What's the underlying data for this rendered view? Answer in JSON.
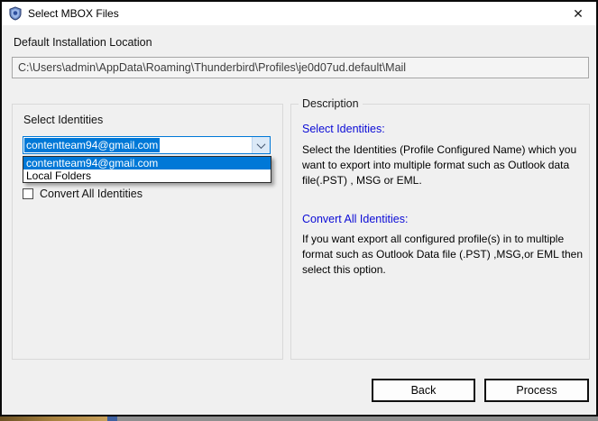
{
  "window": {
    "title": "Select MBOX Files",
    "close_glyph": "✕"
  },
  "location": {
    "label": "Default Installation Location",
    "path": "C:\\Users\\admin\\AppData\\Roaming\\Thunderbird\\Profiles\\je0d07ud.default\\Mail"
  },
  "identities": {
    "label": "Select Identities",
    "value": "contentteam94@gmail.com",
    "options": [
      "contentteam94@gmail.com",
      "Local Folders"
    ],
    "selected_option_index": 0,
    "checkbox_label": "Convert All Identities",
    "checkbox_checked": false
  },
  "description": {
    "legend": "Description",
    "sections": [
      {
        "heading": "Select Identities:",
        "body": "Select the Identities (Profile Configured Name) which you want to export into multiple format such as Outlook data file(.PST) , MSG or EML."
      },
      {
        "heading": "Convert All Identities:",
        "body": "If you want export all configured profile(s) in to multiple format such as Outlook Data file (.PST) ,MSG,or EML then select this option."
      }
    ]
  },
  "buttons": {
    "back": "Back",
    "process": "Process"
  },
  "colors": {
    "accent_blue": "#0078d7",
    "heading_blue": "#0b0bd6",
    "dialog_bg": "#f0f0f0",
    "titlebar_bg": "#ffffff"
  }
}
